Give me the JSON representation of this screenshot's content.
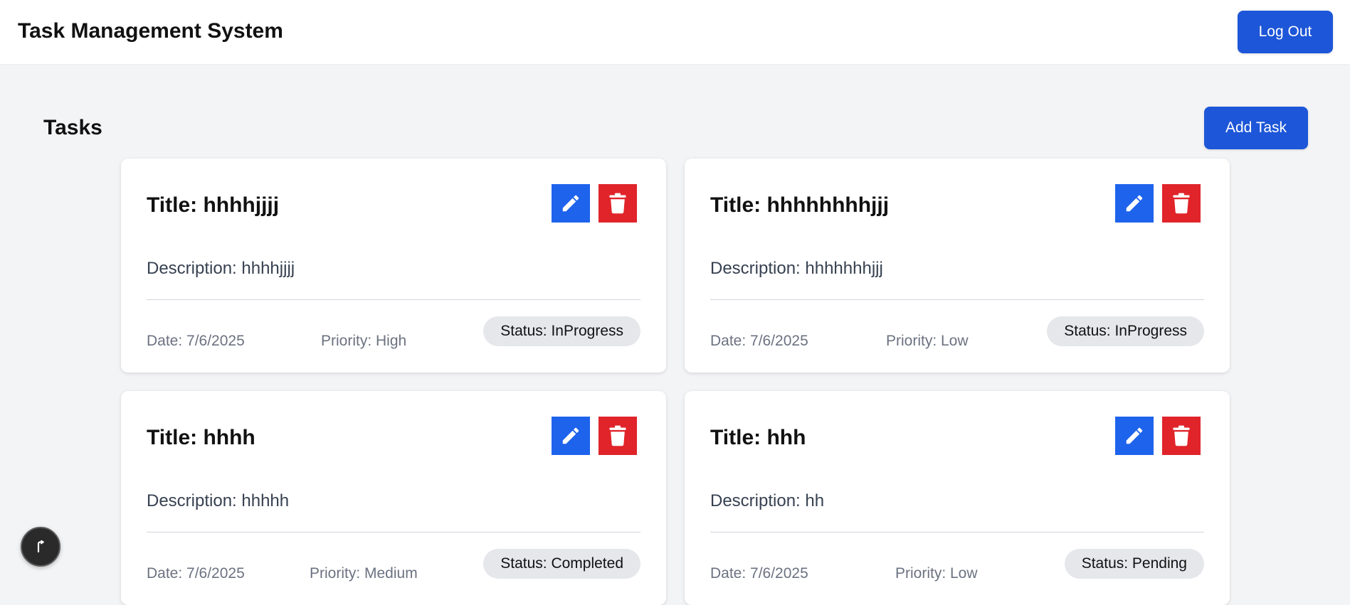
{
  "header": {
    "app_title": "Task Management System",
    "logout_label": "Log Out"
  },
  "main": {
    "section_title": "Tasks",
    "add_task_label": "Add Task"
  },
  "tasks": [
    {
      "title": "Title: hhhhjjjj",
      "description": "Description: hhhhjjjj",
      "date": "Date: 7/6/2025",
      "priority": "Priority: High",
      "status": "Status: InProgress"
    },
    {
      "title": "Title: hhhhhhhhjjj",
      "description": "Description: hhhhhhhjjj",
      "date": "Date: 7/6/2025",
      "priority": "Priority: Low",
      "status": "Status: InProgress"
    },
    {
      "title": "Title: hhhh",
      "description": "Description: hhhhh",
      "date": "Date: 7/6/2025",
      "priority": "Priority: Medium",
      "status": "Status: Completed"
    },
    {
      "title": "Title: hhh",
      "description": "Description: hh",
      "date": "Date: 7/6/2025",
      "priority": "Priority: Low",
      "status": "Status: Pending"
    }
  ],
  "icons": {
    "edit": "pencil-icon",
    "delete": "trash-icon",
    "fab": "cursor-icon"
  },
  "colors": {
    "primary_button": "#1d56d8",
    "edit_button": "#1e63ec",
    "delete_button": "#e0242a",
    "status_pill": "#e5e7eb",
    "page_background": "#f3f4f6"
  }
}
